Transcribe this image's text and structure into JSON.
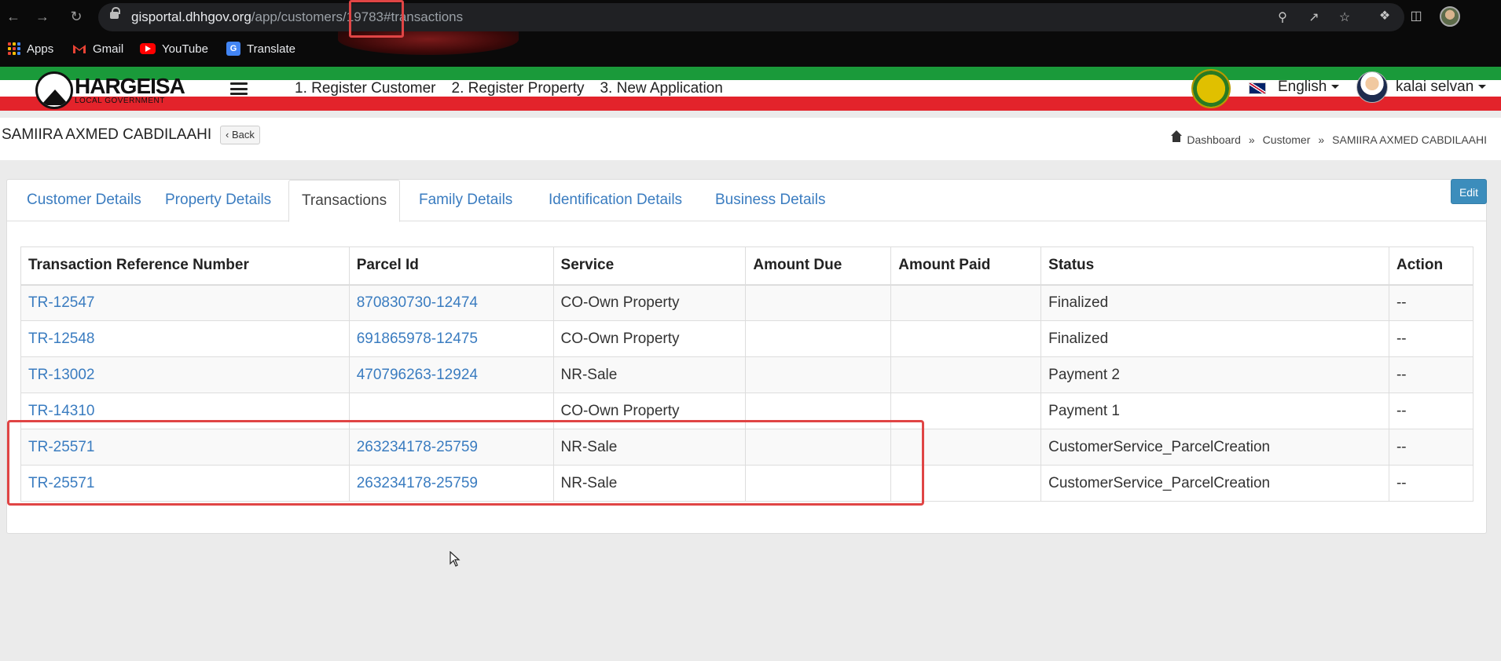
{
  "browser": {
    "url_host": "gisportal.dhhgov.org",
    "url_path": "/app/customers/19783#transactions",
    "bookmarks": [
      "Apps",
      "Gmail",
      "YouTube",
      "Translate"
    ]
  },
  "header": {
    "logo_title": "HARGEISA",
    "logo_subtitle": "LOCAL GOVERNMENT",
    "nav": [
      "1. Register Customer",
      "2. Register Property",
      "3. New Application"
    ],
    "language": "English",
    "user": "kalai selvan"
  },
  "page": {
    "title": "SAMIIRA AXMED CABDILAAHI",
    "back_label": "Back",
    "breadcrumb": [
      "Dashboard",
      "Customer",
      "SAMIIRA AXMED CABDILAAHI"
    ]
  },
  "tabs": [
    "Customer Details",
    "Property Details",
    "Transactions",
    "Family Details",
    "Identification Details",
    "Business Details"
  ],
  "active_tab": "Transactions",
  "edit_label": "Edit",
  "table": {
    "headers": [
      "Transaction Reference Number",
      "Parcel Id",
      "Service",
      "Amount Due",
      "Amount Paid",
      "Status",
      "Action"
    ],
    "rows": [
      [
        "TR-12547",
        "870830730-12474",
        "CO-Own Property",
        "",
        "",
        "Finalized",
        "--"
      ],
      [
        "TR-12548",
        "691865978-12475",
        "CO-Own Property",
        "",
        "",
        "Finalized",
        "--"
      ],
      [
        "TR-13002",
        "470796263-12924",
        "NR-Sale",
        "",
        "",
        "Payment 2",
        "--"
      ],
      [
        "TR-14310",
        "",
        "CO-Own Property",
        "",
        "",
        "Payment 1",
        "--"
      ],
      [
        "TR-25571",
        "263234178-25759",
        "NR-Sale",
        "",
        "",
        "CustomerService_ParcelCreation",
        "--"
      ],
      [
        "TR-25571",
        "263234178-25759",
        "NR-Sale",
        "",
        "",
        "CustomerService_ParcelCreation",
        "--"
      ]
    ]
  },
  "colors": {
    "link": "#3a7cc0",
    "highlight": "#e04545",
    "flag_green": "#1a9a3a",
    "flag_red": "#e3232b",
    "edit_button": "#3c8dbc"
  }
}
